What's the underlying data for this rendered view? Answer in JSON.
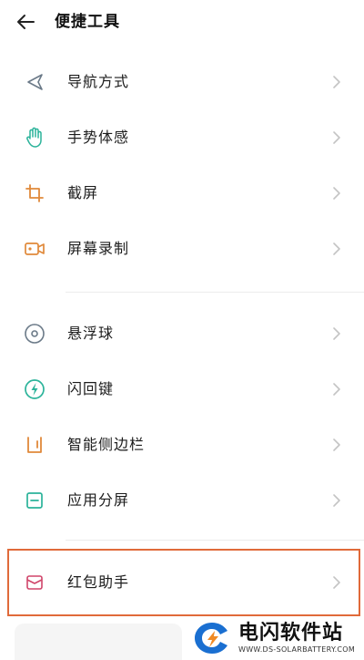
{
  "header": {
    "title": "便捷工具"
  },
  "items": [
    {
      "label": "导航方式"
    },
    {
      "label": "手势体感"
    },
    {
      "label": "截屏"
    },
    {
      "label": "屏幕录制"
    },
    {
      "label": "悬浮球"
    },
    {
      "label": "闪回键"
    },
    {
      "label": "智能侧边栏"
    },
    {
      "label": "应用分屏"
    },
    {
      "label": "红包助手"
    }
  ],
  "watermark": {
    "title": "电闪软件站",
    "subtitle": "WWW.DS-SOLARBATTERY.COM"
  },
  "colors": {
    "highlight": "#e06a3a",
    "accent_green": "#2bb39a",
    "accent_orange": "#e0893a"
  }
}
